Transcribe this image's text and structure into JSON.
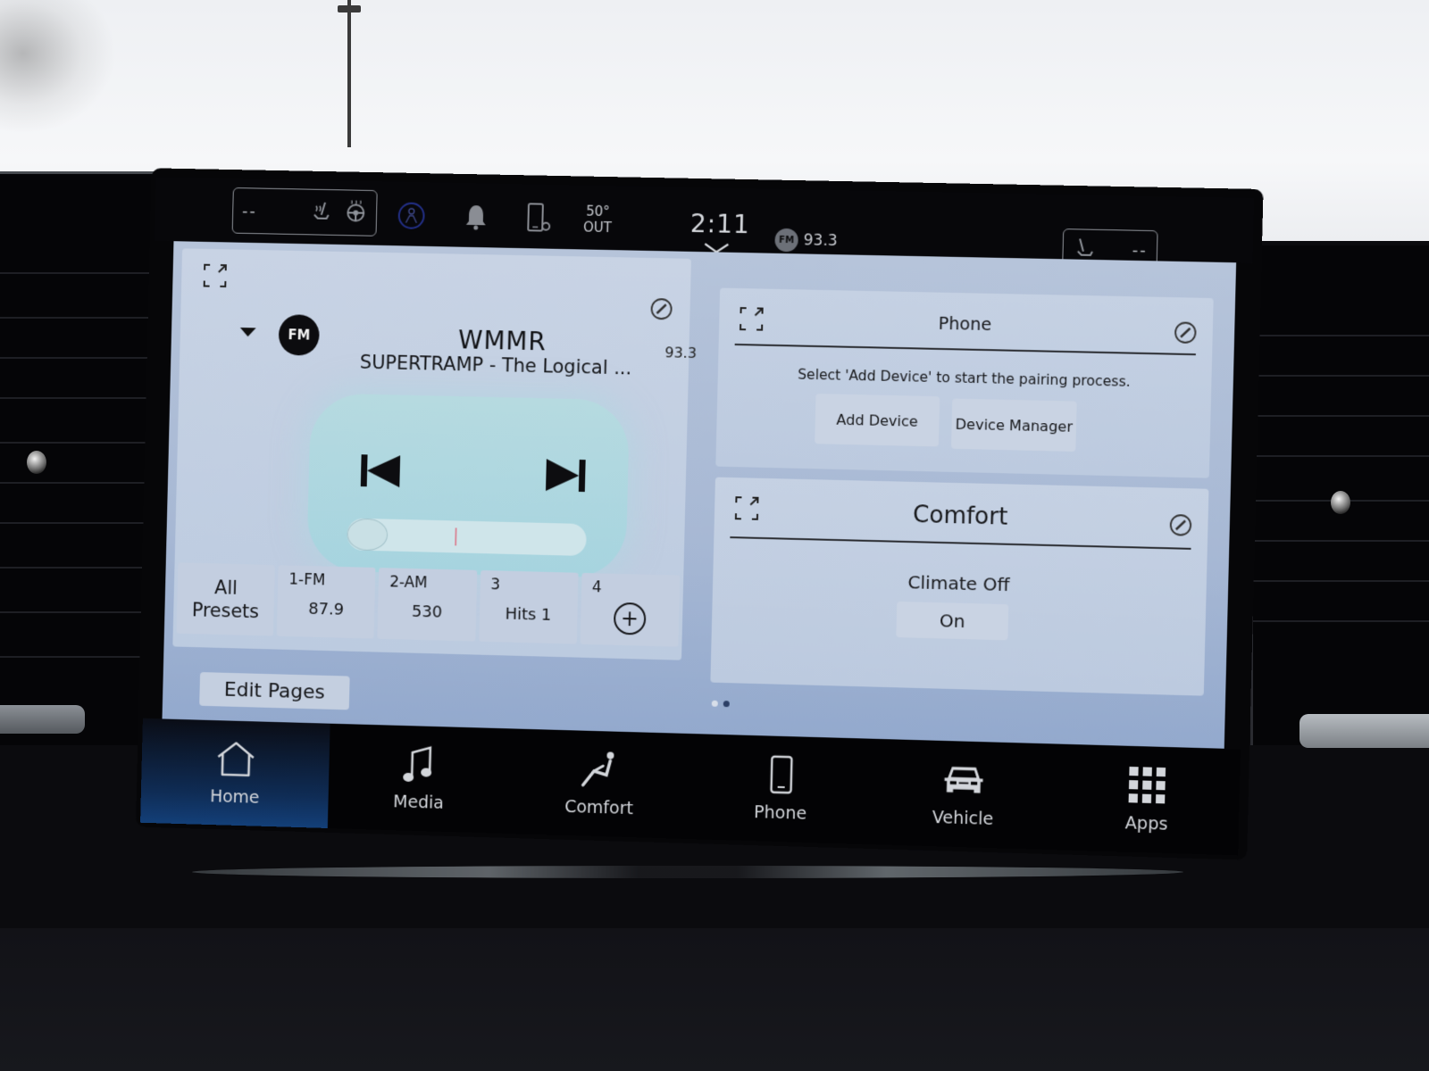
{
  "status_bar": {
    "left_seat_display": "--",
    "right_seat_display": "--",
    "temperature": "50°",
    "temperature_label": "OUT",
    "clock": "2:11",
    "radio_band": "FM",
    "radio_frequency": "93.3",
    "icons": [
      "heated-seat-icon",
      "heated-steering-wheel-icon",
      "passenger-airbag-icon",
      "notification-bell-icon",
      "phone-settings-icon",
      "chevron-down-icon",
      "heated-seat-icon"
    ]
  },
  "media_widget": {
    "band": "FM",
    "station": "WMMR",
    "now_playing": "SUPERTRAMP - The Logical ...",
    "frequency": "93.3",
    "seek_position_fraction": 0.45,
    "presets": [
      {
        "label": "All Presets",
        "line1": "All",
        "line2": "Presets"
      },
      {
        "number": "1-FM",
        "value": "87.9"
      },
      {
        "number": "2-AM",
        "value": "530"
      },
      {
        "number": "3",
        "value": "Hits 1"
      },
      {
        "number": "4",
        "value": "+"
      }
    ]
  },
  "phone_widget": {
    "title": "Phone",
    "message": "Select 'Add Device' to start the pairing process.",
    "add_device_label": "Add Device",
    "device_manager_label": "Device Manager"
  },
  "comfort_widget": {
    "title": "Comfort",
    "climate_status": "Climate Off",
    "on_button_label": "On"
  },
  "page": {
    "edit_pages_label": "Edit Pages",
    "page_count": 2,
    "current_page": 2
  },
  "nav": [
    {
      "label": "Home",
      "icon": "home-icon",
      "active": true
    },
    {
      "label": "Media",
      "icon": "music-note-icon",
      "active": false
    },
    {
      "label": "Comfort",
      "icon": "reclined-seat-icon",
      "active": false
    },
    {
      "label": "Phone",
      "icon": "smartphone-icon",
      "active": false
    },
    {
      "label": "Vehicle",
      "icon": "car-icon",
      "active": false
    },
    {
      "label": "Apps",
      "icon": "apps-grid-icon",
      "active": false
    }
  ],
  "colors": {
    "nav_active": "#133f78",
    "screen_background": "#a7b8d4",
    "widget_background": "#c5d1e3",
    "player_pad": "#a6d4df"
  }
}
